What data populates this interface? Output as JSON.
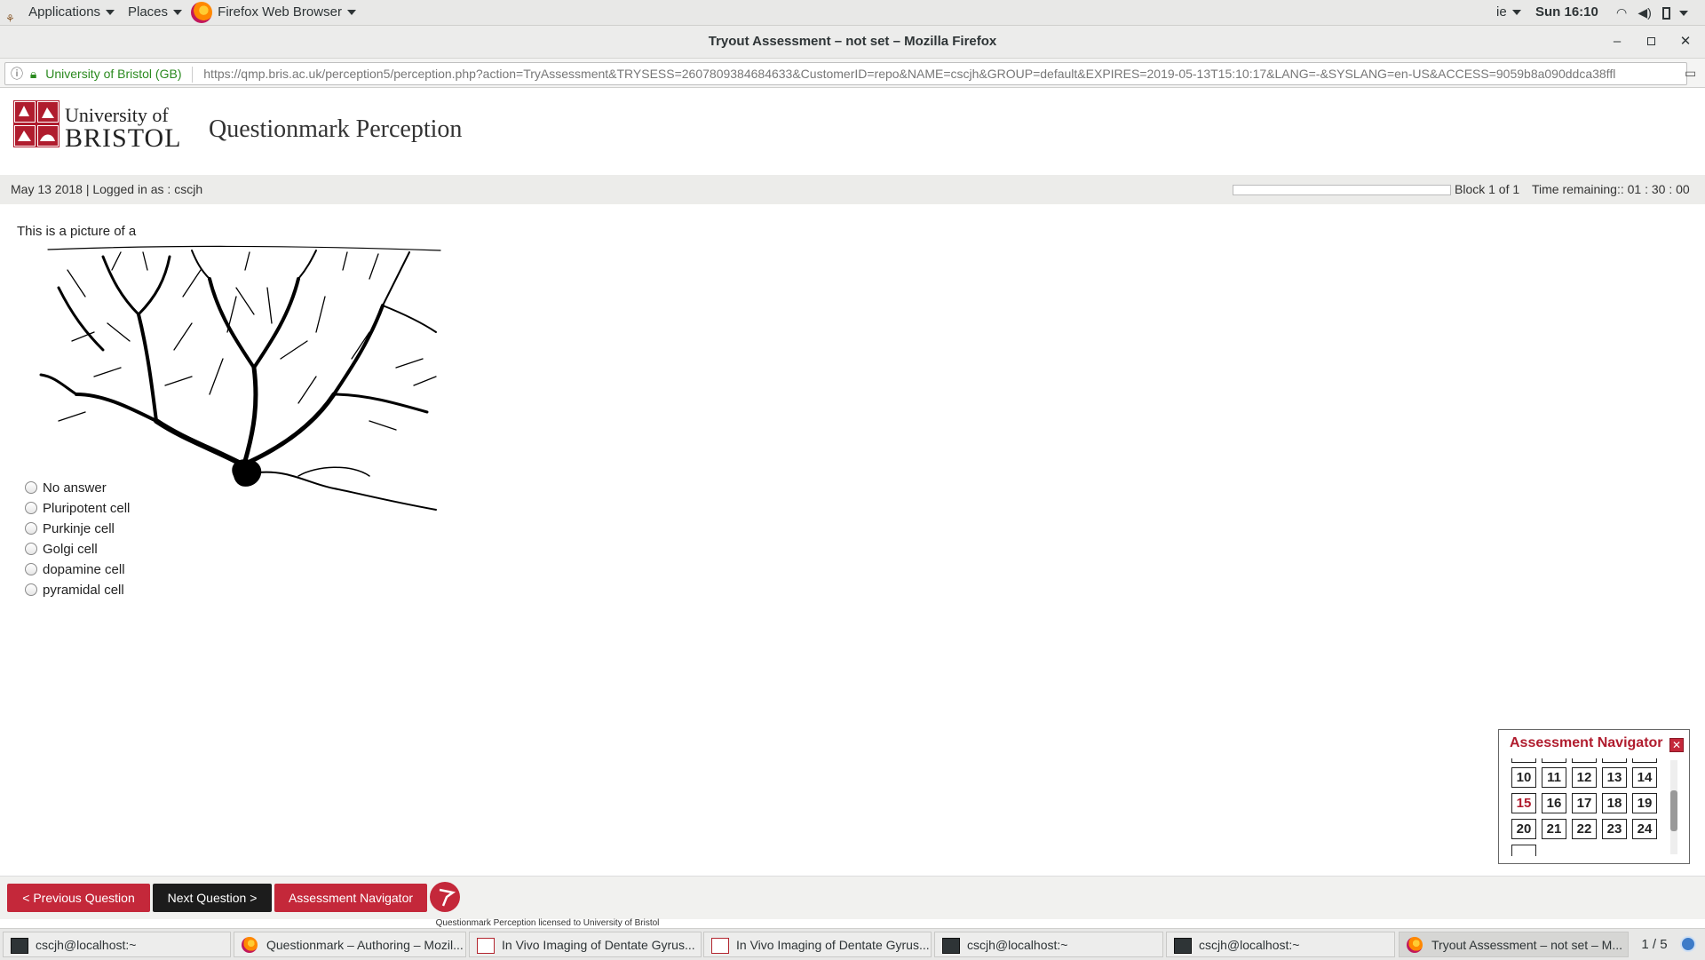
{
  "topbar": {
    "applications": "Applications",
    "places": "Places",
    "active_app": "Firefox Web Browser",
    "input_method": "ie",
    "clock": "Sun 16:10"
  },
  "window": {
    "title": "Tryout Assessment – not set – Mozilla Firefox"
  },
  "urlbar": {
    "identity": "University of Bristol (GB)",
    "url": "https://qmp.bris.ac.uk/perception5/perception.php?action=TryAssessment&TRYSESS=2607809384684633&CustomerID=repo&NAME=cscjh&GROUP=default&EXPIRES=2019-05-13T15:10:17&LANG=-&SYSLANG=en-US&ACCESS=9059b8a090ddca38ffl"
  },
  "header": {
    "logo_line1": "University of",
    "logo_line2": "BRISTOL",
    "app_title": "Questionmark Perception"
  },
  "infobar": {
    "session": "May 13 2018 | Logged in as : cscjh",
    "block": "Block 1 of 1",
    "time_remaining": "Time remaining:: 01 : 30 : 00",
    "progress": 0.0
  },
  "question": {
    "text": "This is a picture of a",
    "options": [
      "No answer",
      "Pluripotent cell",
      "Purkinje cell",
      "Golgi cell",
      "dopamine cell",
      "pyramidal cell"
    ]
  },
  "navigator": {
    "title": "Assessment Navigator",
    "rows": [
      [
        "10",
        "11",
        "12",
        "13",
        "14"
      ],
      [
        "15",
        "16",
        "17",
        "18",
        "19"
      ],
      [
        "20",
        "21",
        "22",
        "23",
        "24"
      ]
    ],
    "current": "15",
    "current_color": "#b01c2e"
  },
  "buttons": {
    "prev": "< Previous Question",
    "next": "Next Question >",
    "navigator": "Assessment Navigator"
  },
  "license": "Questionmark Perception licensed to University of Bristol",
  "taskbar": {
    "tasks": [
      "cscjh@localhost:~",
      "Questionmark – Authoring – Mozil...",
      "In Vivo Imaging of Dentate Gyrus...",
      "In Vivo Imaging of Dentate Gyrus...",
      "cscjh@localhost:~",
      "cscjh@localhost:~",
      "Tryout Assessment – not set – M..."
    ],
    "workspace": "1 / 5"
  },
  "colors": {
    "brand_red": "#b01c2e",
    "dark_button": "#1c1c1c"
  }
}
